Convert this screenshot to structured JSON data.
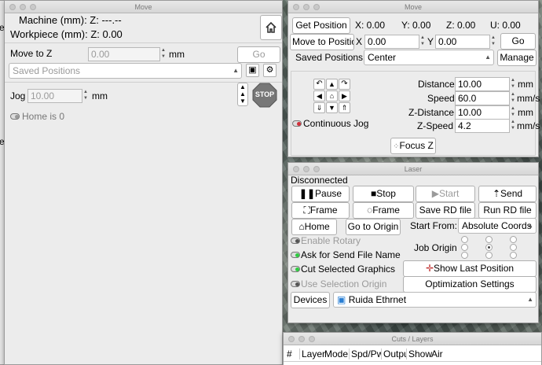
{
  "move_left": {
    "title": "Move",
    "machine_label": "Machine (mm): Z: ---.--",
    "workpiece_label": "Workpiece (mm): Z: 0.00",
    "move_to_z_label": "Move to Z",
    "move_to_z_value": "0.00",
    "unit": "mm",
    "go": "Go",
    "saved_positions": "Saved Positions",
    "jog_label": "Jog",
    "jog_value": "10.00",
    "jog_unit": "mm",
    "stop": "STOP",
    "home_status": "Home is 0"
  },
  "move_right": {
    "title": "Move",
    "get_position": "Get Position",
    "x_coord": "X: 0.00",
    "y_coord": "Y: 0.00",
    "z_coord": "Z: 0.00",
    "u_coord": "U: 0.00",
    "move_to_position": "Move to Position",
    "x_label": "X",
    "x_value": "0.00",
    "y_label": "Y",
    "y_value": "0.00",
    "go": "Go",
    "saved_positions_label": "Saved Positions:",
    "saved_positions_value": "Center",
    "manage": "Manage",
    "distance_label": "Distance",
    "distance_value": "10.00",
    "distance_unit": "mm",
    "speed_label": "Speed",
    "speed_value": "60.0",
    "speed_unit": "mm/s",
    "zdistance_label": "Z-Distance",
    "zdistance_value": "10.00",
    "zdistance_unit": "mm",
    "zspeed_label": "Z-Speed",
    "zspeed_value": "4.2",
    "zspeed_unit": "mm/s",
    "continuous_jog": "Continuous Jog",
    "focus_z": "Focus Z"
  },
  "laser": {
    "title": "Laser",
    "status": "Disconnected",
    "pause": "Pause",
    "stop": "Stop",
    "start": "Start",
    "send": "Send",
    "frame1": "Frame",
    "frame2": "Frame",
    "save_rd": "Save RD file",
    "run_rd": "Run RD file",
    "home": "Home",
    "go_to_origin": "Go to Origin",
    "start_from_label": "Start From:",
    "start_from_value": "Absolute Coords",
    "enable_rotary": "Enable Rotary",
    "ask_send": "Ask for Send File Name",
    "cut_selected": "Cut Selected Graphics",
    "use_selection_origin": "Use Selection Origin",
    "job_origin": "Job Origin",
    "show_last_position": "Show Last Position",
    "optimization_settings": "Optimization Settings",
    "devices": "Devices",
    "device_value": "Ruida Ethrnet",
    "led_green": "#2ecc40",
    "led_red": "#d0303a"
  },
  "cuts": {
    "title": "Cuts / Layers",
    "columns": [
      "#",
      "Layer",
      "Mode",
      "Spd/Pwr",
      "Output",
      "Show",
      "Air"
    ]
  },
  "left_edge": {
    "item1": "er",
    "item2": "er"
  }
}
